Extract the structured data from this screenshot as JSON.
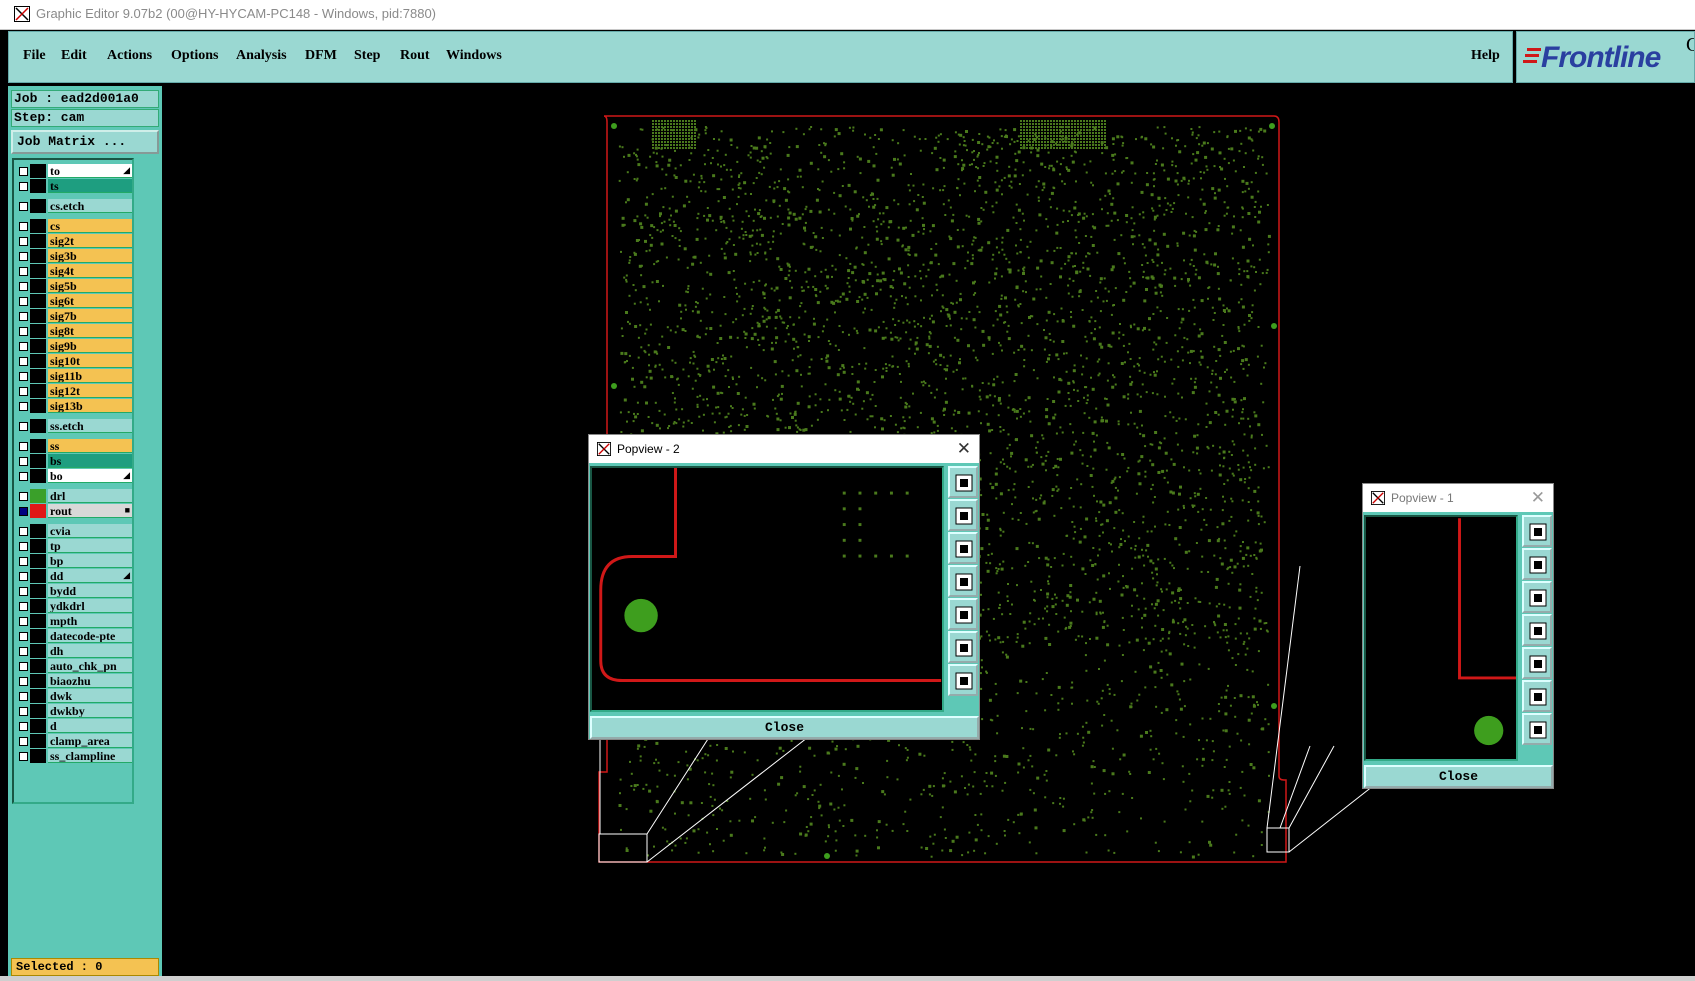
{
  "window": {
    "title": "Graphic Editor 9.07b2 (00@HY-HYCAM-PC148 - Windows, pid:7880)"
  },
  "menu": {
    "items": [
      "File",
      "Edit",
      "Actions",
      "Options",
      "Analysis",
      "DFM",
      "Step",
      "Rout",
      "Windows"
    ],
    "help": "Help"
  },
  "logo": {
    "text": "Frontline",
    "tail": "G"
  },
  "job": {
    "job_line": "Job : ead2d001a0",
    "step_line": "Step: cam",
    "matrix_button": "Job Matrix ..."
  },
  "layers": [
    {
      "name": "to",
      "color": "#ffffff",
      "gap": false
    },
    {
      "name": "ts",
      "color": "#1e9e80",
      "gap": false
    },
    {
      "name": "cs.etch",
      "color": "#9ad8d2",
      "gap": true
    },
    {
      "name": "cs",
      "color": "#f4c252",
      "gap": true
    },
    {
      "name": "sig2t",
      "color": "#f4c252",
      "gap": false
    },
    {
      "name": "sig3b",
      "color": "#f4c252",
      "gap": false
    },
    {
      "name": "sig4t",
      "color": "#f4c252",
      "gap": false
    },
    {
      "name": "sig5b",
      "color": "#f4c252",
      "gap": false
    },
    {
      "name": "sig6t",
      "color": "#f4c252",
      "gap": false
    },
    {
      "name": "sig7b",
      "color": "#f4c252",
      "gap": false
    },
    {
      "name": "sig8t",
      "color": "#f4c252",
      "gap": false
    },
    {
      "name": "sig9b",
      "color": "#f4c252",
      "gap": false
    },
    {
      "name": "sig10t",
      "color": "#f4c252",
      "gap": false
    },
    {
      "name": "sig11b",
      "color": "#f4c252",
      "gap": false
    },
    {
      "name": "sig12t",
      "color": "#f4c252",
      "gap": false
    },
    {
      "name": "sig13b",
      "color": "#f4c252",
      "gap": false
    },
    {
      "name": "ss.etch",
      "color": "#9ad8d2",
      "gap": true
    },
    {
      "name": "ss",
      "color": "#f4c252",
      "gap": true
    },
    {
      "name": "bs",
      "color": "#1e9e80",
      "gap": false
    },
    {
      "name": "bo",
      "color": "#ffffff",
      "gap": false
    },
    {
      "name": "drl",
      "color": "#9ad8d2",
      "gap": true
    },
    {
      "name": "rout",
      "color": "#d8d8d8",
      "gap": false
    },
    {
      "name": "cvia",
      "color": "#9ad8d2",
      "gap": true
    },
    {
      "name": "tp",
      "color": "#9ad8d2",
      "gap": false
    },
    {
      "name": "bp",
      "color": "#9ad8d2",
      "gap": false
    },
    {
      "name": "dd",
      "color": "#9ad8d2",
      "gap": false
    },
    {
      "name": "bydd",
      "color": "#9ad8d2",
      "gap": false
    },
    {
      "name": "ydkdrl",
      "color": "#9ad8d2",
      "gap": false
    },
    {
      "name": "mpth",
      "color": "#9ad8d2",
      "gap": false
    },
    {
      "name": "datecode-pte",
      "color": "#9ad8d2",
      "gap": false
    },
    {
      "name": "dh",
      "color": "#9ad8d2",
      "gap": false
    },
    {
      "name": "auto_chk_pn",
      "color": "#9ad8d2",
      "gap": false
    },
    {
      "name": "biaozhu",
      "color": "#9ad8d2",
      "gap": false
    },
    {
      "name": "dwk",
      "color": "#9ad8d2",
      "gap": false
    },
    {
      "name": "dwkby",
      "color": "#9ad8d2",
      "gap": false
    },
    {
      "name": "d",
      "color": "#9ad8d2",
      "gap": false
    },
    {
      "name": "clamp_area",
      "color": "#9ad8d2",
      "gap": false
    },
    {
      "name": "ss_clampline",
      "color": "#9ad8d2",
      "gap": false
    }
  ],
  "selected_text": "Selected : 0",
  "popview2": {
    "title": "Popview - 2",
    "close_label": "Close"
  },
  "popview1": {
    "title": "Popview - 1",
    "close_label": "Close"
  },
  "colors": {
    "board_copper": "#4a7a1c",
    "outline": "#d01818",
    "panel": "#5ec8b6",
    "menu": "#9ad8d2"
  }
}
